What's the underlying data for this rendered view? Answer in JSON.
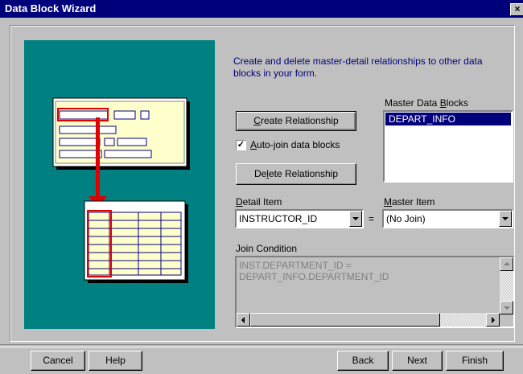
{
  "window": {
    "title": "Data Block Wizard",
    "close_glyph": "×"
  },
  "description": "Create and delete master-detail relationships to other data blocks in your form.",
  "buttons": {
    "create_relationship": {
      "prefix": "",
      "mnemonic": "C",
      "rest": "reate Relationship"
    },
    "delete_relationship": {
      "prefix": "De",
      "mnemonic": "l",
      "rest": "ete Relationship"
    }
  },
  "auto_join": {
    "checked": true,
    "check_glyph": "✓",
    "mnemonic": "A",
    "rest": "uto-join data blocks"
  },
  "master_blocks": {
    "label_prefix": "Master Data ",
    "label_mnemonic": "B",
    "label_rest": "locks",
    "items": [
      "DEPART_INFO"
    ]
  },
  "detail_item": {
    "label_mnemonic": "D",
    "label_rest": "etail Item",
    "value": "INSTRUCTOR_ID"
  },
  "equals": "=",
  "master_item": {
    "label_mnemonic": "M",
    "label_rest": "aster Item",
    "value": "(No Join)"
  },
  "join_condition": {
    "label": "Join Condition",
    "text": "INST.DEPARTMENT_ID =\nDEPART_INFO.DEPARTMENT_ID"
  },
  "footer": {
    "cancel": "Cancel",
    "help": "Help",
    "back": "Back",
    "next": "Next",
    "finish": "Finish"
  },
  "illustration": "master-detail-diagram",
  "colors": {
    "title_bar": "#00007b",
    "illustration_bg": "#008080",
    "description_text": "#00007b",
    "selection": "#00007b",
    "arrow": "#ff0000",
    "form_bg": "#ffffcc"
  }
}
